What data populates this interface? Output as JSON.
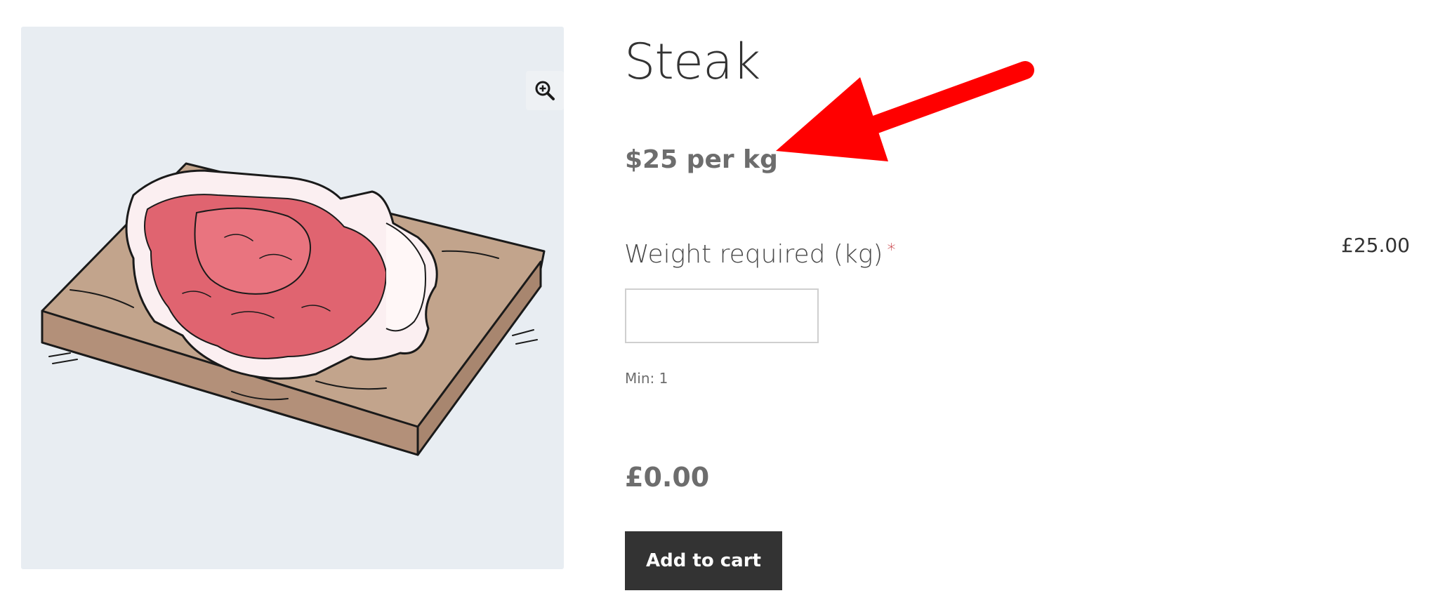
{
  "product": {
    "title": "Steak",
    "price_per_unit": "$25 per kg",
    "image_alt": "Steak on a cutting board"
  },
  "icons": {
    "zoom": "zoom-in-icon",
    "annotation": "red-arrow"
  },
  "form": {
    "weight_label": "Weight required (kg)",
    "required_mark": "*",
    "field_price": "£25.00",
    "weight_value": "",
    "weight_placeholder": "",
    "min_note": "Min: 1"
  },
  "totals": {
    "total": "£0.00"
  },
  "actions": {
    "add_to_cart_label": "Add to cart"
  },
  "colors": {
    "button_bg": "#333333",
    "annotation_red": "#ff0000",
    "required_red": "#c0262d",
    "gallery_bg": "#e8edf2",
    "meat": "#e06470",
    "board": "#c2a48c"
  }
}
